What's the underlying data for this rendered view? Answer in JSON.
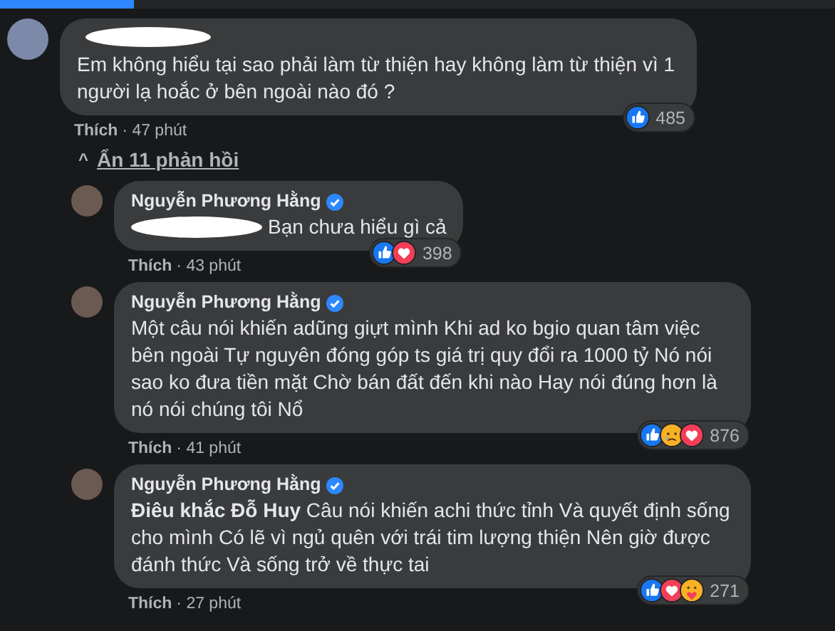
{
  "progress": {
    "level": 0.16
  },
  "comment": {
    "name_hidden": true,
    "text": "Em không hiểu tại sao phải làm từ thiện hay không làm từ thiện vì 1 người lạ hoắc ở bên ngoài nào đó ?",
    "reactions": [
      {
        "kind": "like"
      }
    ],
    "reaction_count": "485",
    "like": "Thích",
    "time": "· 47 phút"
  },
  "replies_toggle": {
    "icon": "^",
    "label": "Ẩn 11 phản hồi"
  },
  "replies": [
    {
      "author": "Nguyễn Phương Hằng",
      "verified": true,
      "mention_hidden": true,
      "text": "Bạn chưa hiểu gì cả",
      "reactions": [
        {
          "kind": "like"
        },
        {
          "kind": "love"
        }
      ],
      "reaction_count": "398",
      "like": "Thích",
      "time": "· 43 phút"
    },
    {
      "author": "Nguyễn Phương Hằng",
      "verified": true,
      "text": "Một câu nói khiến adũng giựt mình Khi ad ko bgio quan tâm việc bên ngoài Tự nguyên đóng góp ts giá trị quy đổi ra 1000 tỷ Nó nói sao ko đưa tiền mặt Chờ bán đất đến khi nào Hay nói đúng hơn là nó nói chúng tôi Nổ",
      "reactions": [
        {
          "kind": "like"
        },
        {
          "kind": "sad"
        },
        {
          "kind": "love"
        }
      ],
      "reaction_count": "876",
      "like": "Thích",
      "time": "· 41 phút"
    },
    {
      "author": "Nguyễn Phương Hằng",
      "verified": true,
      "text": "**Điêu khắc Đỗ Huy** Câu nói khiến achi thức tỉnh Và quyết định sống cho mình Có lẽ vì ngủ quên với trái tim lượng thiện Nên giờ được đánh thức Và sống trở về thực tai",
      "reactions": [
        {
          "kind": "like"
        },
        {
          "kind": "love"
        },
        {
          "kind": "care"
        }
      ],
      "reaction_count": "271",
      "like": "Thích",
      "time": "· 27 phút"
    }
  ]
}
